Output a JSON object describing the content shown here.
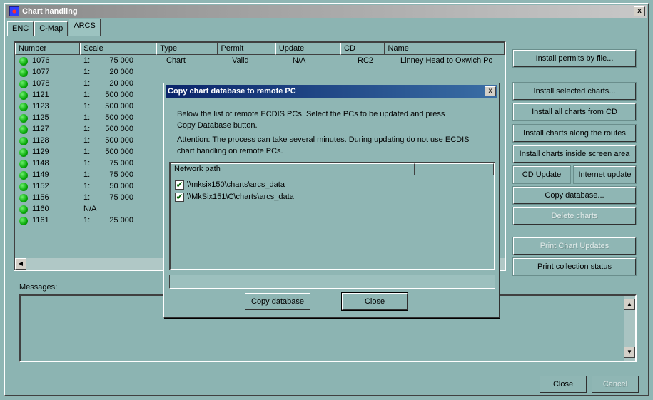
{
  "window": {
    "title": "Chart handling",
    "close_glyph": "x"
  },
  "tabs": [
    "ENC",
    "C-Map",
    "ARCS"
  ],
  "active_tab": "ARCS",
  "table": {
    "columns": [
      "Number",
      "Scale",
      "Type",
      "Permit",
      "Update",
      "CD",
      "Name"
    ],
    "rows": [
      {
        "number": "1076",
        "scale_prefix": "1:",
        "scale": "75 000",
        "type": "Chart",
        "permit": "Valid",
        "update": "N/A",
        "cd": "RC2",
        "name": "Linney Head to Oxwich Pc"
      },
      {
        "number": "1077",
        "scale_prefix": "1:",
        "scale": "20 000"
      },
      {
        "number": "1078",
        "scale_prefix": "1:",
        "scale": "20 000"
      },
      {
        "number": "1121",
        "scale_prefix": "1:",
        "scale": "500 000"
      },
      {
        "number": "1123",
        "scale_prefix": "1:",
        "scale": "500 000"
      },
      {
        "number": "1125",
        "scale_prefix": "1:",
        "scale": "500 000"
      },
      {
        "number": "1127",
        "scale_prefix": "1:",
        "scale": "500 000"
      },
      {
        "number": "1128",
        "scale_prefix": "1:",
        "scale": "500 000"
      },
      {
        "number": "1129",
        "scale_prefix": "1:",
        "scale": "500 000"
      },
      {
        "number": "1148",
        "scale_prefix": "1:",
        "scale": "75 000"
      },
      {
        "number": "1149",
        "scale_prefix": "1:",
        "scale": "75 000"
      },
      {
        "number": "1152",
        "scale_prefix": "1:",
        "scale": "50 000"
      },
      {
        "number": "1156",
        "scale_prefix": "1:",
        "scale": "75 000"
      },
      {
        "number": "1160",
        "scale_prefix": "N/A",
        "scale": ""
      },
      {
        "number": "1161",
        "scale_prefix": "1:",
        "scale": "25 000"
      }
    ]
  },
  "side_buttons": [
    {
      "label": "Install permits by file...",
      "enabled": true
    },
    {
      "label": "Install selected charts...",
      "enabled": true
    },
    {
      "label": "Install all charts from CD",
      "enabled": true
    },
    {
      "label": "Install charts along the routes",
      "enabled": true
    },
    {
      "label": "Install charts inside screen area",
      "enabled": true
    },
    {
      "label": "CD Update",
      "enabled": true
    },
    {
      "label": "Internet update",
      "enabled": true
    },
    {
      "label": "Copy database...",
      "enabled": true
    },
    {
      "label": "Delete charts",
      "enabled": false
    },
    {
      "label": "Print Chart Updates",
      "enabled": false
    },
    {
      "label": "Print collection status",
      "enabled": true
    }
  ],
  "messages": {
    "label": "Messages:"
  },
  "bottom_buttons": {
    "close": "Close",
    "cancel": "Cancel"
  },
  "dialog": {
    "title": "Copy chart database to remote PC",
    "close_glyph": "x",
    "text1_line1": "Below the list of remote ECDIS PCs. Select the PCs to be updated and press",
    "text1_line2": "Copy  Database button.",
    "text2_line1": "Attention: The process can take several minutes. During updating do not use ECDIS",
    "text2_line2": "chart handling on remote PCs.",
    "list_header": "Network path",
    "paths": [
      {
        "path": "\\\\mksix150\\charts\\arcs_data",
        "checked": true
      },
      {
        "path": "\\\\MkSix151\\C\\charts\\arcs_data",
        "checked": true
      }
    ],
    "copy_button": "Copy database",
    "close_button": "Close"
  }
}
